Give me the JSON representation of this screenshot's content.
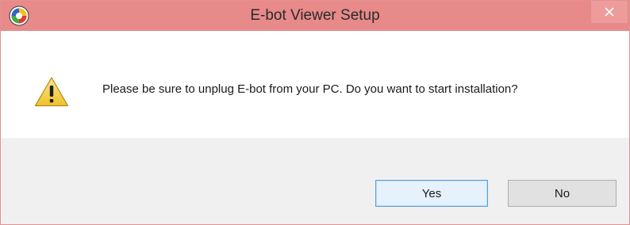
{
  "window": {
    "title": "E-bot Viewer Setup",
    "app_icon": "ebot-app-icon",
    "close_icon": "close-icon"
  },
  "dialog": {
    "icon": "warning-icon",
    "message": "Please be sure to unplug E-bot from your PC. Do you want to start installation?"
  },
  "buttons": {
    "yes_label": "Yes",
    "no_label": "No",
    "default": "Yes"
  },
  "colors": {
    "titlebar": "#e88a8a",
    "footer": "#f0f0f0",
    "default_button_border": "#5d9edd",
    "warning_yellow": "#f5cf3d"
  }
}
